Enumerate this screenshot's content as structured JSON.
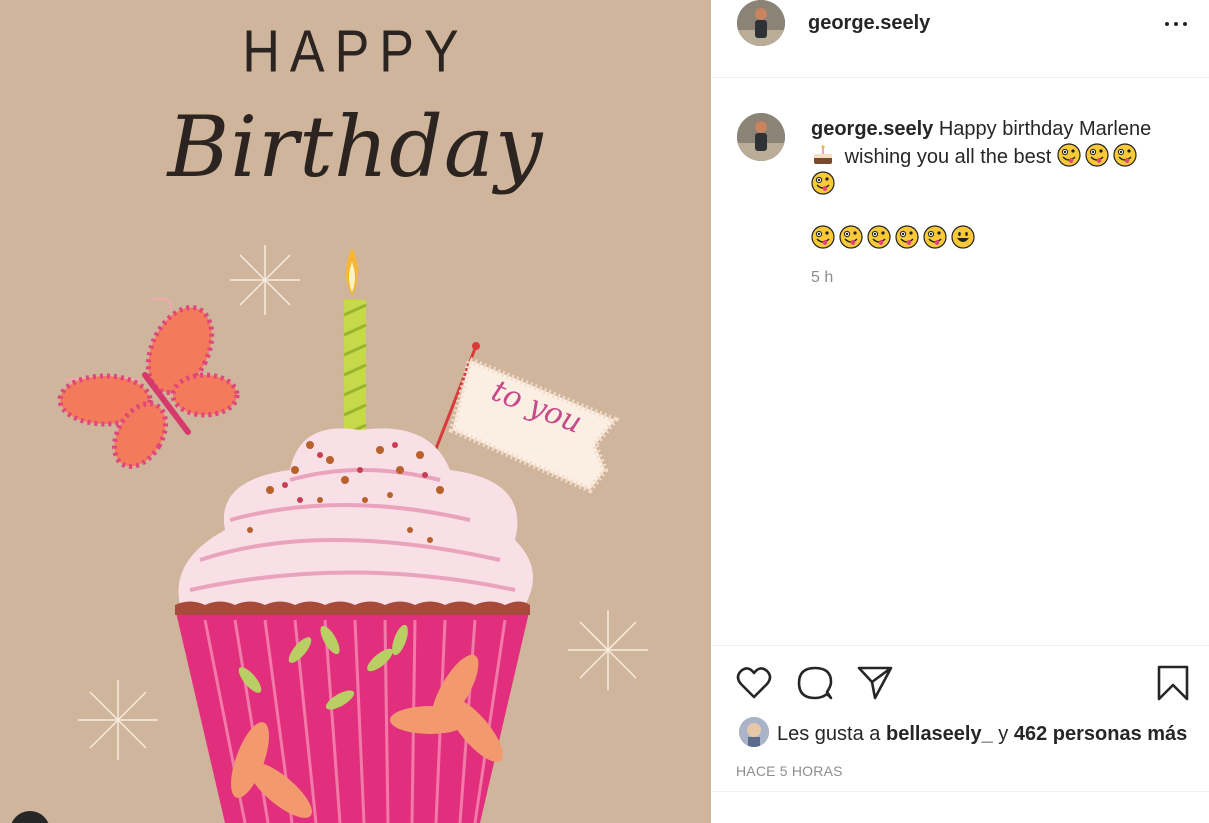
{
  "post": {
    "image": {
      "title_line1": "HAPPY",
      "title_line2": "Birthday",
      "flag_text": "to you"
    },
    "header": {
      "username": "george.seely"
    },
    "caption": {
      "username": "george.seely",
      "text_before_cake": "Happy birthday Marlene",
      "text_after_cake": "wishing you all the best",
      "time": "5 h"
    },
    "likes": {
      "prefix": "Les gusta a",
      "liker": "bellaseely_",
      "middle": "y",
      "count_text": "462 personas más"
    },
    "posted_ago": "HACE 5 HORAS"
  },
  "icons": {
    "options": "more-horizontal-icon",
    "like": "heart-icon",
    "comment": "speech-bubble-icon",
    "share": "paper-plane-icon",
    "save": "bookmark-icon",
    "emoji_cake": "cake-emoji",
    "emoji_zany": "zany-face-emoji",
    "emoji_grin": "grinning-face-emoji"
  },
  "colors": {
    "card_background": "#cfb59c",
    "text_primary": "#262626",
    "text_secondary": "#8e8e8e",
    "divider": "#efefef",
    "frosting": "#f7d4de",
    "wrapper": "#e12f7e"
  }
}
